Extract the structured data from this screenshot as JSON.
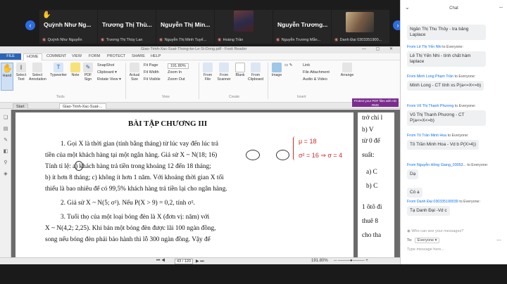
{
  "participants": [
    {
      "big": "Quỳnh Như Ng...",
      "small": "Quỳnh Như Nguyễn"
    },
    {
      "big": "Trương Thị Thù...",
      "small": "Trương Thị Thùy Lan"
    },
    {
      "big": "Nguyễn Thị Min...",
      "small": "Nguyễn Thị Minh Tuyế..."
    },
    {
      "big": "",
      "small": "Hoàng Trần"
    },
    {
      "big": "Nguyễn Trương...",
      "small": "Nguyễn Trương Mẫn..."
    },
    {
      "big": "",
      "small": "Danh Đại 0303351900..."
    }
  ],
  "foxit": {
    "title": "Giao-Trinh-Xac-Suat-Thong-ke-Le-Si-Dong.pdf - Foxit Reader",
    "menus": [
      "FILE",
      "HOME",
      "COMMENT",
      "VIEW",
      "FORM",
      "PROTECT",
      "SHARE",
      "HELP"
    ],
    "ribbon": {
      "hand": "Hand",
      "select_text": "Select Text",
      "select_annotation": "Select Annotation",
      "typewriter": "Typewriter",
      "note": "Note",
      "pdf_sign": "PDF Sign",
      "snapshot": "SnapShot",
      "clipboard": "Clipboard ▾",
      "rotate": "Rotate View ▾",
      "actual_size": "Actual Size",
      "fit_page": "Fit Page",
      "fit_width": "Fit Width",
      "fit_visible": "Fit Visible",
      "zoom_value": "191.80%",
      "zoom_in": "Zoom In",
      "zoom_out": "Zoom Out",
      "from_file": "From File",
      "from_scanner": "From Scanner",
      "blank": "Blank",
      "from_clipboard": "From Clipboard",
      "image": "Image",
      "audio_video": "Audio & Video",
      "link": "Link",
      "file_attachment": "File Attachment",
      "arrange": "Arrange",
      "groups": {
        "tools": "Tools",
        "view": "View",
        "create": "Create",
        "insert": "Insert"
      }
    },
    "promo": "Protect your PDF files with AD RMS",
    "tabs": [
      "Start",
      "Giao-Trinh-Xac-Suat-..."
    ],
    "page": {
      "heading": "BÀI TẬP CHƯƠNG III",
      "lines": [
        "1. Gọi X là thời gian (tính bằng tháng) từ lúc vay đến lúc trả",
        "tiền của một khách hàng tại một ngân hàng. Giả sử X ~ N(18; 16)",
        "Tính tỉ lệ: a) khách hàng trả tiền trong khoảng 12 đến 18 tháng;",
        "b) ít hơn 8 tháng; c) không ít hơn 1 năm. Với khoảng thời gian X tối",
        "thiểu là bao nhiêu để có 99,5% khách hàng trả tiền lại cho ngân hàng.",
        "2. Giả sử X ~ N(5; σ²). Nếu P(X > 9) = 0,2, tính σ².",
        "3. Tuổi thọ của một loại bóng đèn là X (đơn vị: năm) với",
        "X ~ N(4,2; 2,25). Khi bán một bóng đèn được lãi 100 ngàn đồng,",
        "song nếu bóng đèn phải bảo hành thì lỗ 300 ngàn đồng. Vậy để"
      ],
      "annotation_mu": "μ = 18",
      "annotation_sigma": "σ² = 16 ⇒ σ = 4",
      "right_col": [
        "trở chỉ l",
        "b) V",
        "từ 0 đế",
        "suất:",
        "a) C",
        "b) C",
        "1 ôtô đi",
        "thuê 8",
        "cho tha"
      ]
    },
    "status": {
      "page": "43 / 120",
      "zoom": "191.80%"
    }
  },
  "chat": {
    "title": "Chat",
    "messages": [
      {
        "from": "",
        "to": "",
        "text": "Ngân Thị Thu Thủy - tra bảng Laplace"
      },
      {
        "from": "From Lê Thị Yến Nhi",
        "to": "to Everyone:",
        "text": "Lê Thị Yến Nhi - tính chất hàm laplace"
      },
      {
        "from": "From Minh Long Phạm Trần",
        "to": "to Everyone:",
        "text": "Minh Long - CT tính xs P(a<=X<=b)"
      },
      {
        "from": "From Võ Thị Thanh Phương",
        "to": "to Everyone:",
        "text": "Võ Thị Thanh Phương - CT P(a<=X<=b)"
      },
      {
        "from": "From Tô Trần Minh Hoa",
        "to": "to Everyone:",
        "text": "Tô Trần Minh Hoa - Vd b P(X>4))"
      },
      {
        "from": "From Nguyễn Hồng Giang_03053...",
        "to": "to Everyone:",
        "text": "Dạ"
      },
      {
        "from": "",
        "to": "",
        "text": "Có a"
      },
      {
        "from": "From Danh Đại 03033519003​9",
        "to": "to Everyone:",
        "text": "Tạ Danh Đại -Vd c"
      }
    ],
    "who_can_see": "Who can see your messages?",
    "to_label": "To:",
    "to_value": "Everyone ▾",
    "placeholder": "Type message here..."
  },
  "colors": {
    "accent": "#0e71eb",
    "foxit_blue": "#2b64b4",
    "ink_red": "#cc2a2a"
  }
}
